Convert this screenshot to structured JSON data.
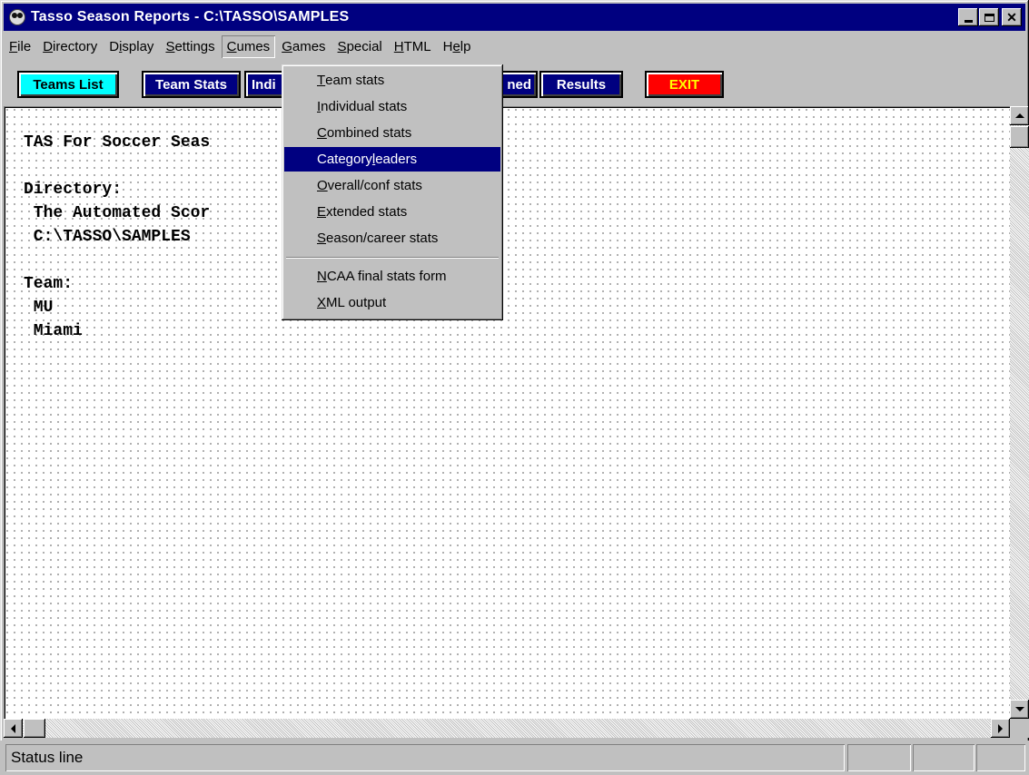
{
  "window": {
    "title": "Tasso Season Reports - C:\\TASSO\\SAMPLES"
  },
  "menubar": [
    {
      "pre": "",
      "key": "F",
      "post": "ile"
    },
    {
      "pre": "",
      "key": "D",
      "post": "irectory"
    },
    {
      "pre": "D",
      "key": "i",
      "post": "splay"
    },
    {
      "pre": "",
      "key": "S",
      "post": "ettings"
    },
    {
      "pre": "",
      "key": "C",
      "post": "umes"
    },
    {
      "pre": "",
      "key": "G",
      "post": "ames"
    },
    {
      "pre": "",
      "key": "S",
      "post": "pecial"
    },
    {
      "pre": "",
      "key": "H",
      "post": "TML"
    },
    {
      "pre": "H",
      "key": "e",
      "post": "lp"
    }
  ],
  "toolbar": {
    "teams_list": "Teams List",
    "team_stats": "Team Stats",
    "individual": "Indi",
    "combined": "ned",
    "results": "Results",
    "exit": "EXIT"
  },
  "content": {
    "lines": [
      "TAS For Soccer Seas",
      "",
      "Directory:",
      " The Automated Scor",
      " C:\\TASSO\\SAMPLES",
      "",
      "Team:",
      " MU",
      " Miami"
    ]
  },
  "cumes_menu": {
    "items": [
      {
        "pre": "",
        "key": "T",
        "post": "eam stats"
      },
      {
        "pre": "",
        "key": "I",
        "post": "ndividual stats"
      },
      {
        "pre": "",
        "key": "C",
        "post": "ombined stats"
      },
      {
        "pre": "Category ",
        "key": "l",
        "post": "eaders"
      },
      {
        "pre": "",
        "key": "O",
        "post": "verall/conf stats"
      },
      {
        "pre": "",
        "key": "E",
        "post": "xtended stats"
      },
      {
        "pre": "",
        "key": "S",
        "post": "eason/career stats"
      },
      {
        "pre": "",
        "key": "N",
        "post": "CAA final stats form"
      },
      {
        "pre": "",
        "key": "X",
        "post": "ML output"
      }
    ],
    "highlighted_index": 3
  },
  "status": {
    "text": "Status line"
  },
  "colors": {
    "titlebar": "#000080",
    "highlight": "#000080",
    "teams_list": "#00ffff",
    "exit": "#ff0000"
  },
  "icons": [
    "app-icon",
    "minimize-icon",
    "maximize-icon",
    "close-icon",
    "scroll-up-icon",
    "scroll-down-icon",
    "scroll-left-icon",
    "scroll-right-icon"
  ]
}
